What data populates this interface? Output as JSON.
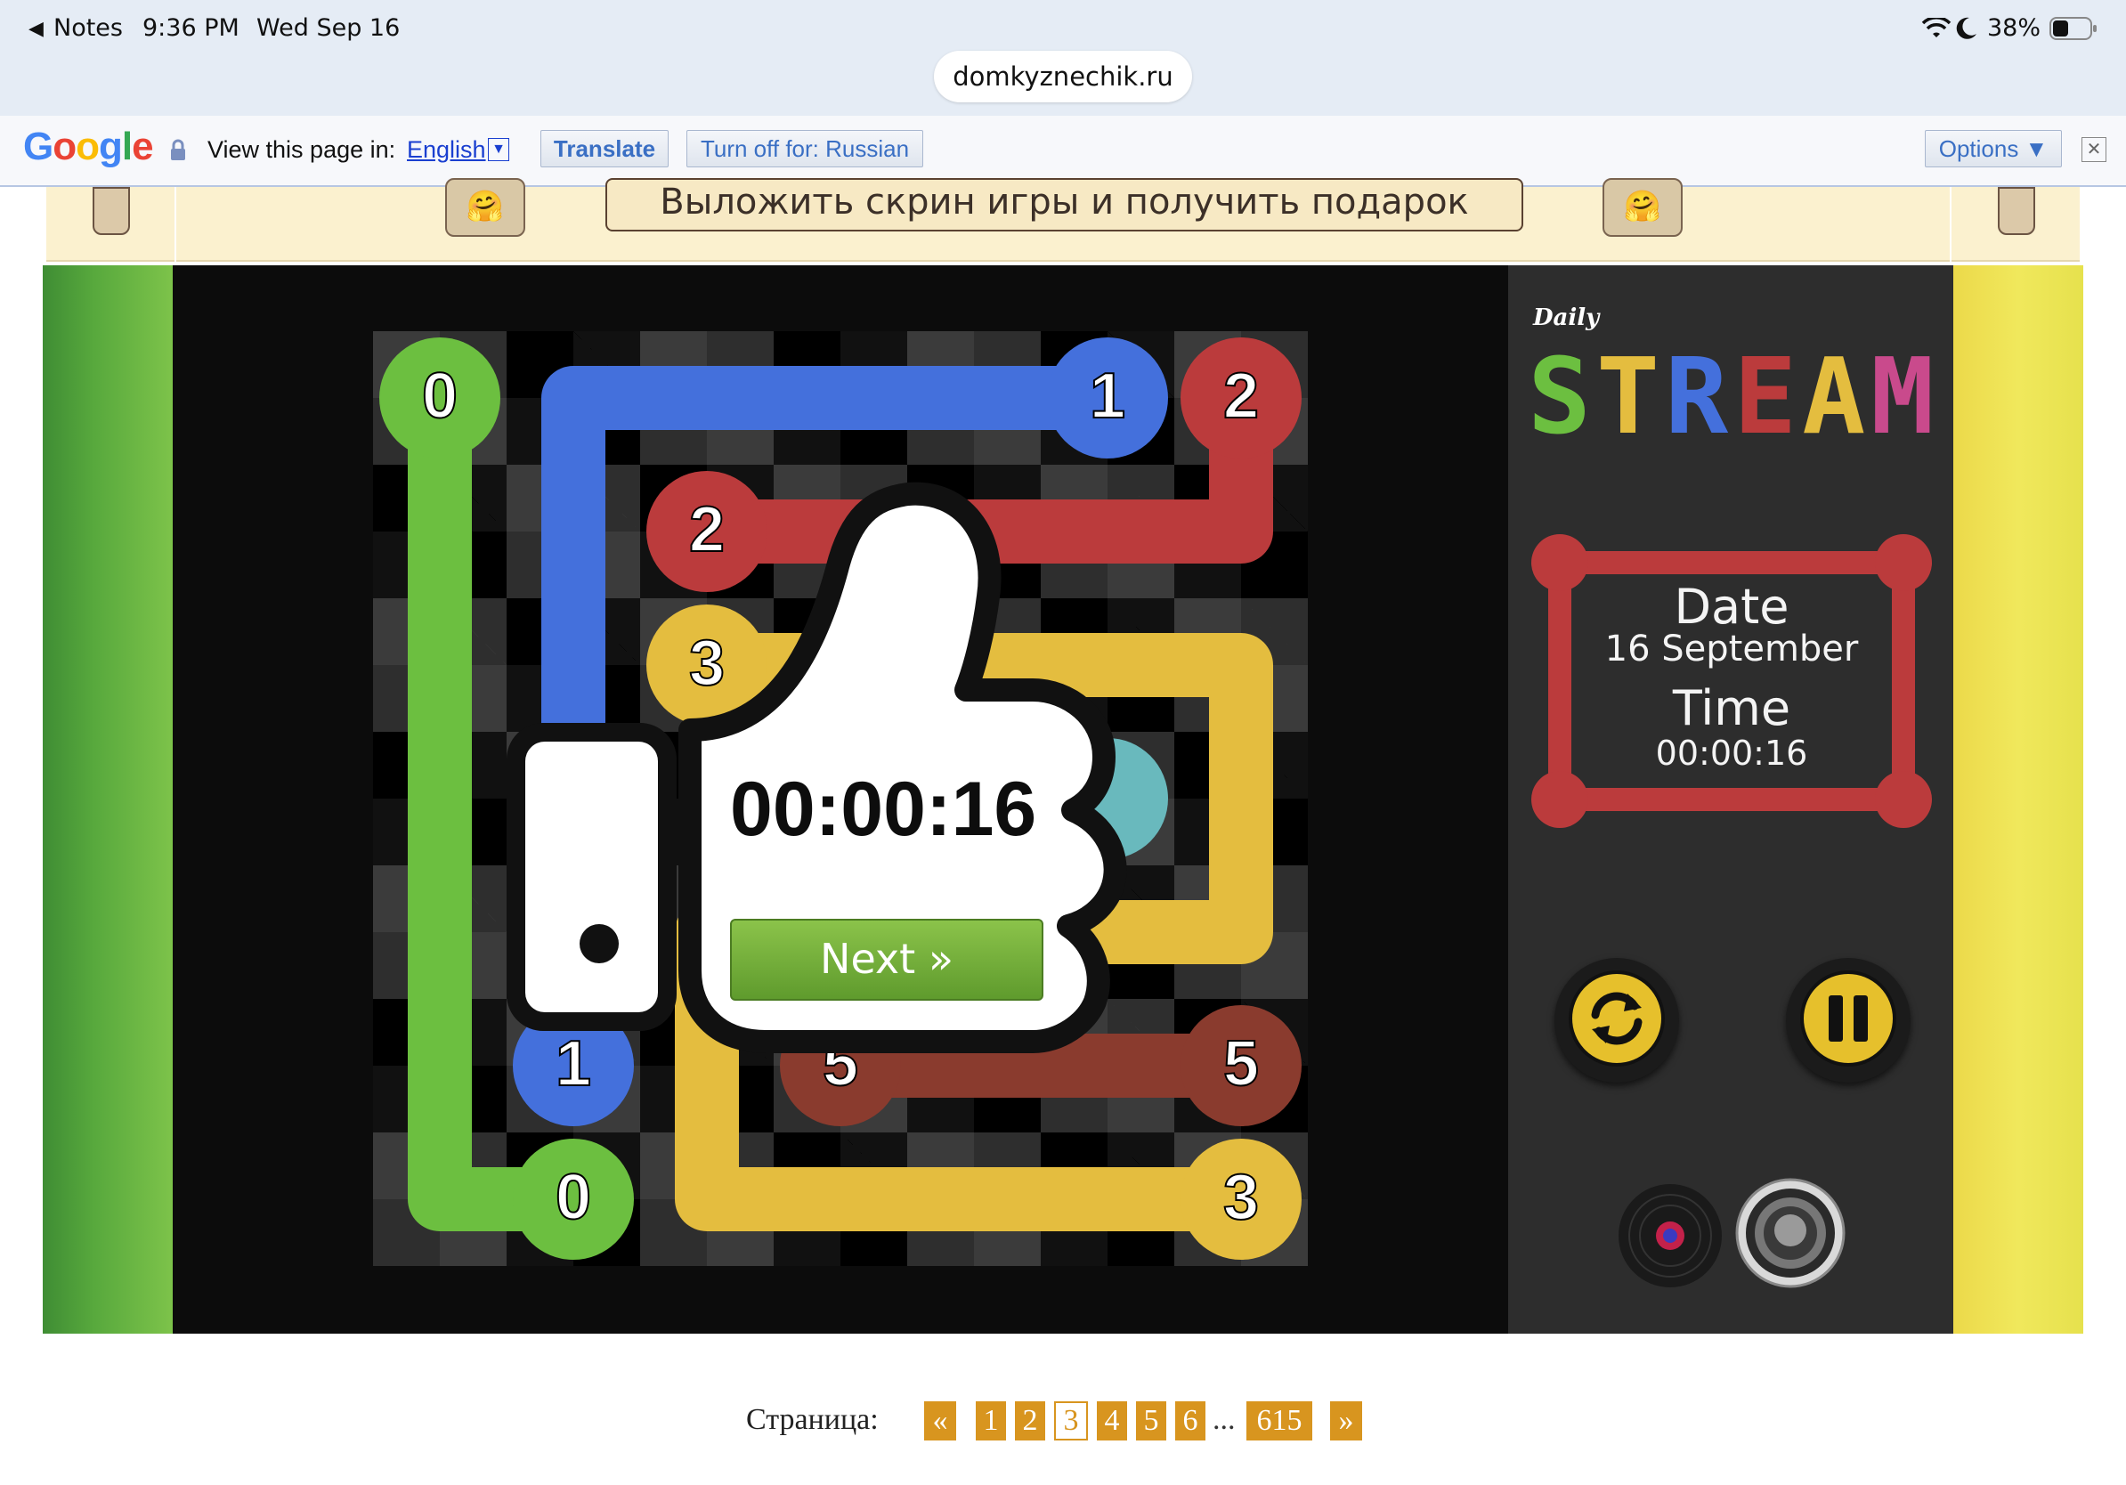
{
  "status_bar": {
    "back_app": "Notes",
    "time": "9:36 PM",
    "date": "Wed Sep 16",
    "battery": "38%",
    "url": "domkyznechik.ru"
  },
  "translate_bar": {
    "logo": "Google",
    "prompt": "View this page in:",
    "language": "English",
    "translate_label": "Translate",
    "turn_off_label": "Turn off for: Russian",
    "options_label": "Options ▼",
    "close_glyph": "✕"
  },
  "banner": {
    "button_text": "Выложить скрин игры и получить подарок",
    "emoji": "🤗"
  },
  "board": {
    "grid_size": 7,
    "colors": {
      "green": "#6cbf40",
      "blue": "#4470dc",
      "red": "#bb3b3c",
      "yellow": "#e4bd3f",
      "teal": "#69b9bd",
      "brown": "#8a3b2e"
    },
    "labels": {
      "green_a": "0",
      "green_b": "0",
      "blue_a": "1",
      "blue_b": "1",
      "red_a": "2",
      "red_b": "2",
      "yellow_a": "3",
      "yellow_b": "3",
      "brown_a": "5",
      "brown_b": "5"
    }
  },
  "result_overlay": {
    "time": "00:00:16",
    "next_label": "Next »"
  },
  "side_panel": {
    "logo_small": "Daily",
    "logo_main": "STREAM",
    "logo_colors": [
      "#6cbf40",
      "#e4bd3f",
      "#4470dc",
      "#bb3b3c",
      "#e4bd3f",
      "#c94a8c",
      "#69b9bd"
    ],
    "date_label": "Date",
    "date_value": "16 September",
    "time_label": "Time",
    "time_value": "00:00:16",
    "frame_color": "#bb3b3c",
    "buttons": {
      "restart_icon": "refresh-icon",
      "pause_icon": "pause-icon",
      "record_icon": "record-icon",
      "speaker_icon": "speaker-icon"
    }
  },
  "pagination": {
    "label": "Страница:",
    "prev": "«",
    "pages": [
      "1",
      "2",
      "3",
      "4",
      "5",
      "6"
    ],
    "current": "3",
    "ellipsis": "...",
    "last": "615",
    "next": "»"
  }
}
